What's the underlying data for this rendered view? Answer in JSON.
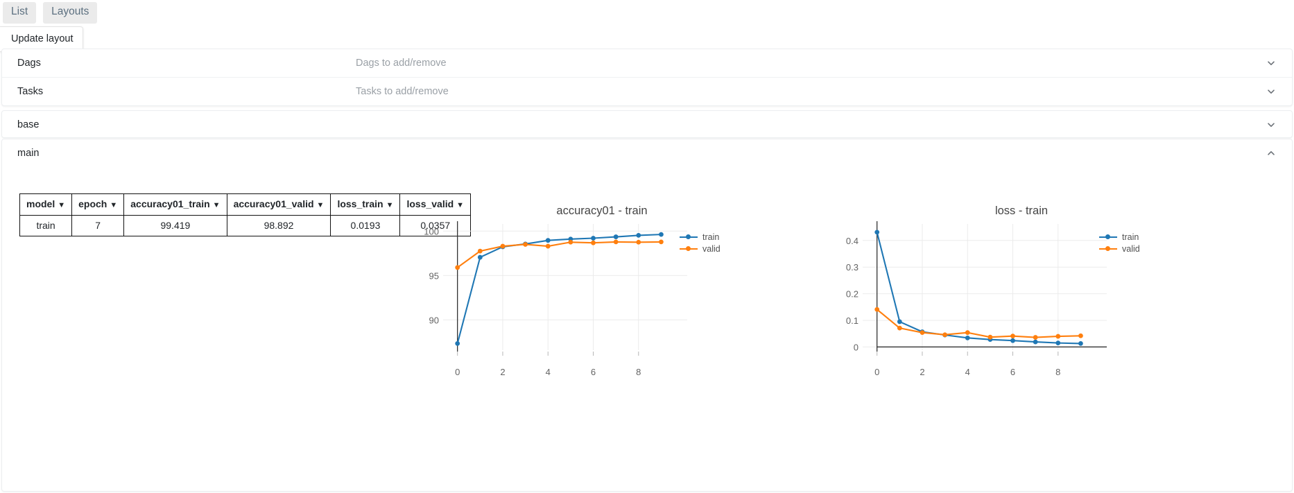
{
  "tabs": [
    {
      "label": "List",
      "name": "tab-list"
    },
    {
      "label": "Layouts",
      "name": "tab-layouts"
    }
  ],
  "toolbar": {
    "update_layout_label": "Update layout"
  },
  "selectors": [
    {
      "label": "Dags",
      "placeholder": "Dags to add/remove",
      "chevron": "chevron-down-icon"
    },
    {
      "label": "Tasks",
      "placeholder": "Tasks to add/remove",
      "chevron": "chevron-down-icon"
    }
  ],
  "sections": [
    {
      "title": "base",
      "expanded": false,
      "chevron": "chevron-down-icon"
    },
    {
      "title": "main",
      "expanded": true,
      "chevron": "chevron-up-icon"
    }
  ],
  "table": {
    "columns": [
      "model",
      "epoch",
      "accuracy01_train",
      "accuracy01_valid",
      "loss_train",
      "loss_valid"
    ],
    "sort_caret": "▼",
    "rows": [
      [
        "train",
        "7",
        "99.419",
        "98.892",
        "0.0193",
        "0.0357"
      ]
    ]
  },
  "colors": {
    "train": "#1f77b4",
    "valid": "#ff7f0e",
    "axis": "#222222",
    "grid": "#ebebeb",
    "tick_text": "#636363",
    "title_text": "#444444",
    "tab_bg": "#ebebeb",
    "tab_text": "#5c7080"
  },
  "chart_data": [
    {
      "type": "line",
      "id": "accuracy",
      "title": "accuracy01 - train",
      "xlabel": "",
      "ylabel": "",
      "x": [
        0,
        1,
        2,
        3,
        4,
        5,
        6,
        7,
        8,
        9
      ],
      "xticks": [
        0,
        2,
        4,
        6,
        8
      ],
      "yticks": [
        90,
        95,
        100
      ],
      "xlim": [
        -0.45,
        9.6
      ],
      "ylim": [
        86.6,
        100.8
      ],
      "grid": true,
      "legend_position": "right",
      "series": [
        {
          "name": "train",
          "color": "#1f77b4",
          "values": [
            87.35,
            97.05,
            98.23,
            98.55,
            98.95,
            99.1,
            99.2,
            99.35,
            99.52,
            99.62
          ]
        },
        {
          "name": "valid",
          "color": "#ff7f0e",
          "values": [
            95.9,
            97.75,
            98.3,
            98.5,
            98.3,
            98.75,
            98.68,
            98.78,
            98.75,
            98.78
          ]
        }
      ]
    },
    {
      "type": "line",
      "id": "loss",
      "title": "loss - train",
      "xlabel": "",
      "ylabel": "",
      "x": [
        0,
        1,
        2,
        3,
        4,
        5,
        6,
        7,
        8,
        9
      ],
      "xticks": [
        0,
        2,
        4,
        6,
        8
      ],
      "yticks": [
        0,
        0.1,
        0.2,
        0.3,
        0.4
      ],
      "ytick_labels": [
        "0",
        "0.1",
        "0.2",
        "0.3",
        "0.4"
      ],
      "xlim": [
        -0.45,
        9.6
      ],
      "ylim": [
        -0.012,
        0.462
      ],
      "grid": true,
      "legend_position": "right",
      "series": [
        {
          "name": "train",
          "color": "#1f77b4",
          "values": [
            0.431,
            0.095,
            0.057,
            0.045,
            0.034,
            0.028,
            0.024,
            0.019,
            0.015,
            0.013
          ]
        },
        {
          "name": "valid",
          "color": "#ff7f0e",
          "values": [
            0.141,
            0.071,
            0.054,
            0.046,
            0.054,
            0.037,
            0.041,
            0.036,
            0.04,
            0.042
          ]
        }
      ]
    }
  ]
}
